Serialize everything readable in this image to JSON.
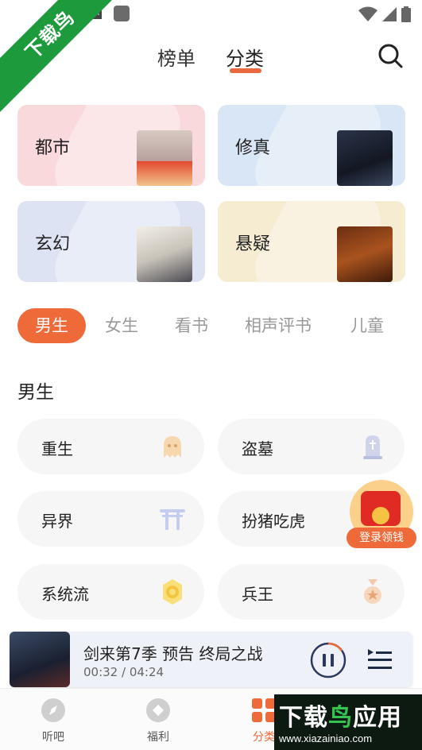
{
  "status_bar": {
    "indicator": "A"
  },
  "watermark": {
    "ribbon": "下载鸟",
    "bottom_main_dark": "下载",
    "bottom_main_green": "鸟",
    "bottom_main_tail": "应用",
    "bottom_url": "www.xiazainiao.com"
  },
  "header": {
    "tabs": [
      {
        "label": "榜单"
      },
      {
        "label": "分类"
      }
    ],
    "active_tab": "分类"
  },
  "category_cards": [
    {
      "title": "都市",
      "color": "#f9d9dc"
    },
    {
      "title": "修真",
      "color": "#d9e6f5"
    },
    {
      "title": "玄幻",
      "color": "#dde3f3"
    },
    {
      "title": "悬疑",
      "color": "#f6ecd2"
    }
  ],
  "filters": [
    {
      "label": "男生"
    },
    {
      "label": "女生"
    },
    {
      "label": "看书"
    },
    {
      "label": "相声评书"
    },
    {
      "label": "儿童"
    }
  ],
  "active_filter": "男生",
  "section": {
    "title": "男生"
  },
  "genres": [
    {
      "label": "重生",
      "icon": "ghost-icon"
    },
    {
      "label": "盗墓",
      "icon": "tombstone-icon"
    },
    {
      "label": "异界",
      "icon": "torii-gate-icon"
    },
    {
      "label": "扮猪吃虎",
      "icon": "pig-icon"
    },
    {
      "label": "系统流",
      "icon": "gear-badge-icon"
    },
    {
      "label": "兵王",
      "icon": "medal-icon"
    }
  ],
  "floating_ad": {
    "label": "登录领钱"
  },
  "player": {
    "title": "剑来第7季 预告 终局之战",
    "time": "00:32 / 04:24"
  },
  "bottom_nav": [
    {
      "label": "听吧"
    },
    {
      "label": "福利"
    },
    {
      "label": "分类"
    }
  ],
  "colors": {
    "accent": "#ef6a39",
    "background": "#ffffff"
  }
}
